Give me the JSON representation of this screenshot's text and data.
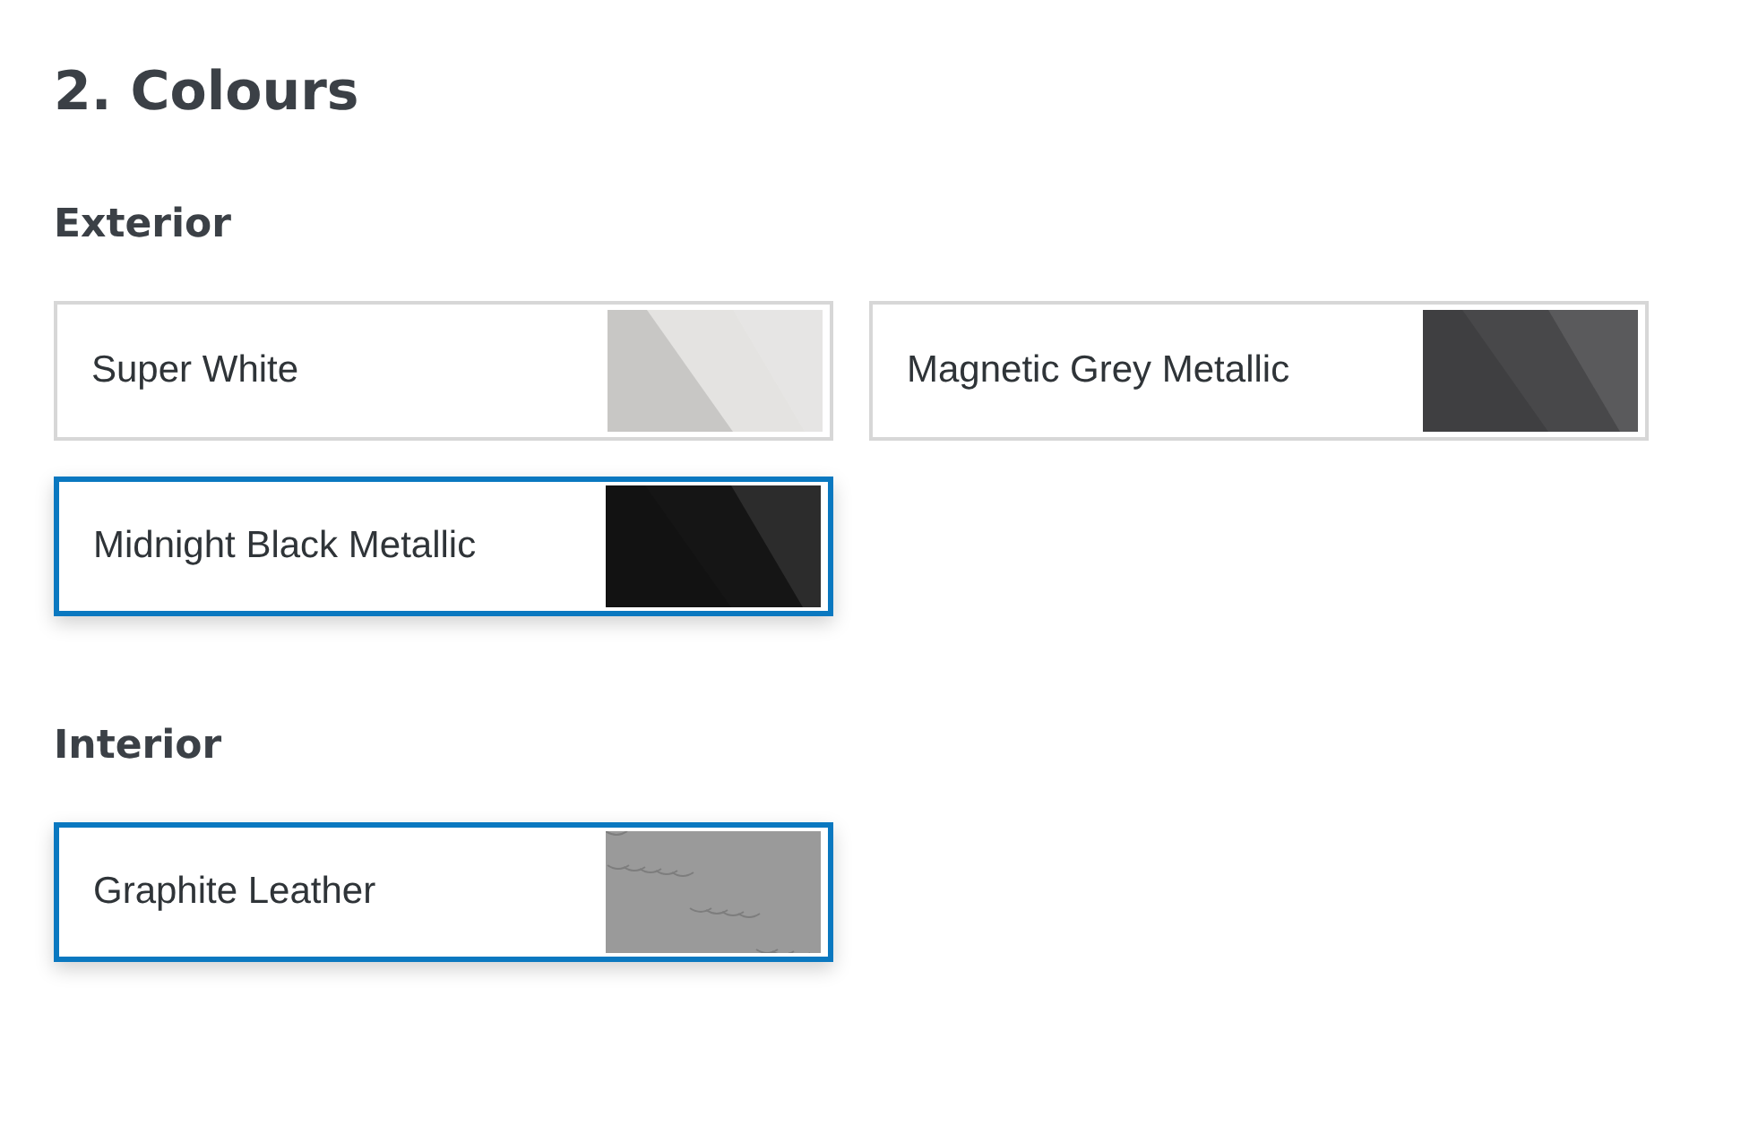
{
  "title": "2. Colours",
  "sections": [
    {
      "heading": "Exterior",
      "options": [
        {
          "label": "Super White",
          "selected": false,
          "kind": "paint",
          "color": "#e4e3e1"
        },
        {
          "label": "Magnetic Grey Metallic",
          "selected": false,
          "kind": "paint",
          "color": "#48484a"
        },
        {
          "label": "Midnight Black Metallic",
          "selected": true,
          "kind": "paint",
          "color": "#151515"
        }
      ]
    },
    {
      "heading": "Interior",
      "options": [
        {
          "label": "Graphite Leather",
          "selected": true,
          "kind": "leather",
          "color": "#9a9a9a"
        }
      ]
    }
  ]
}
